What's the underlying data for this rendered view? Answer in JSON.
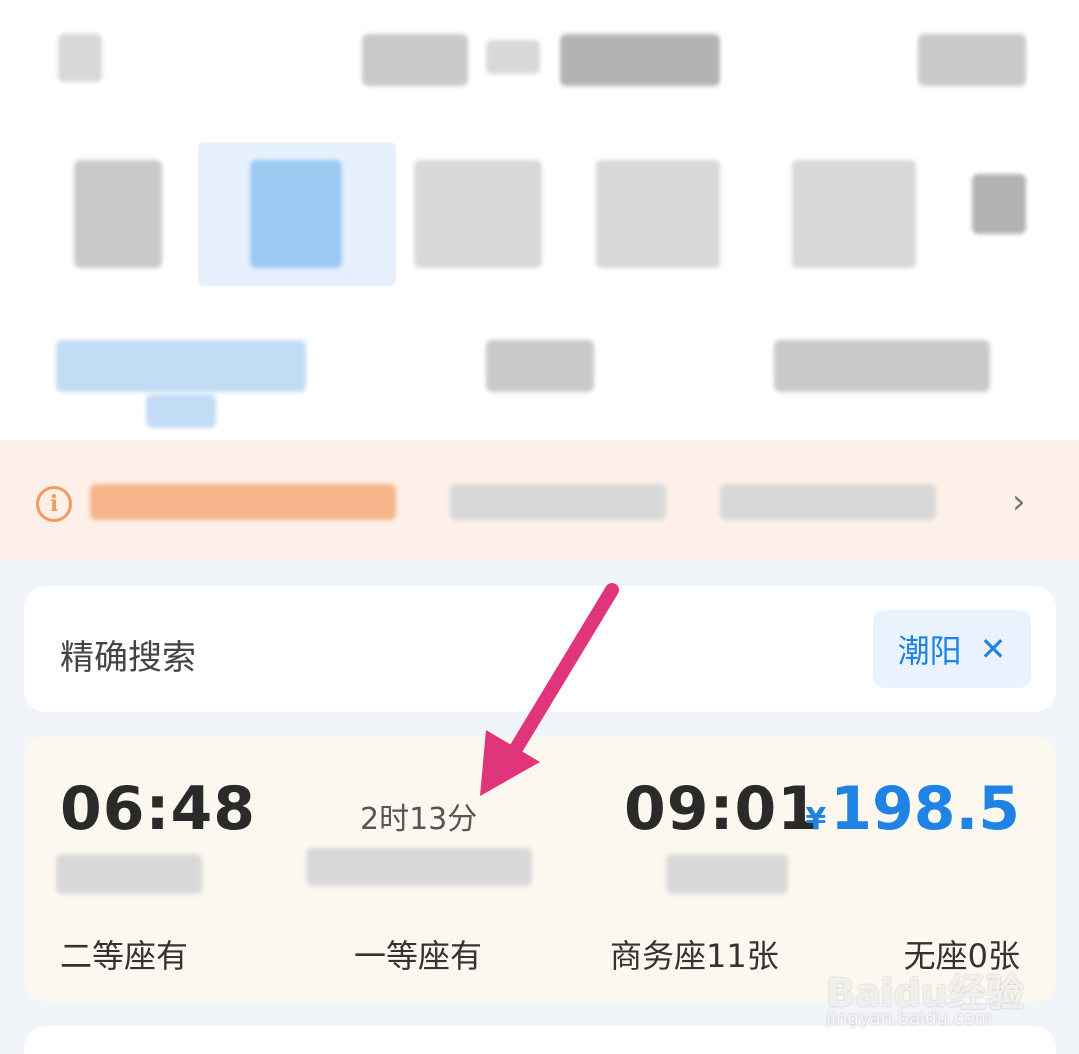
{
  "search": {
    "label": "精确搜索",
    "station_chip": "潮阳",
    "close_symbol": "✕"
  },
  "notice": {
    "icon_symbol": "i",
    "chevron_symbol": "›"
  },
  "train": {
    "departure_time": "06:48",
    "duration": "2时13分",
    "arrival_time": "09:01",
    "currency": "¥",
    "price": "198.5",
    "seats": [
      {
        "label": "二等座有"
      },
      {
        "label": "一等座有"
      },
      {
        "label": "商务座11张"
      },
      {
        "label": "无座0张"
      }
    ]
  },
  "watermark": {
    "brand": "Baidu经验",
    "url": "jingyan.baidu.com"
  },
  "colors": {
    "accent": "#1e83e2",
    "annotation_arrow": "#e0357a",
    "notice_bg": "#fdf0e8",
    "card_bg": "#fcf8f0"
  }
}
